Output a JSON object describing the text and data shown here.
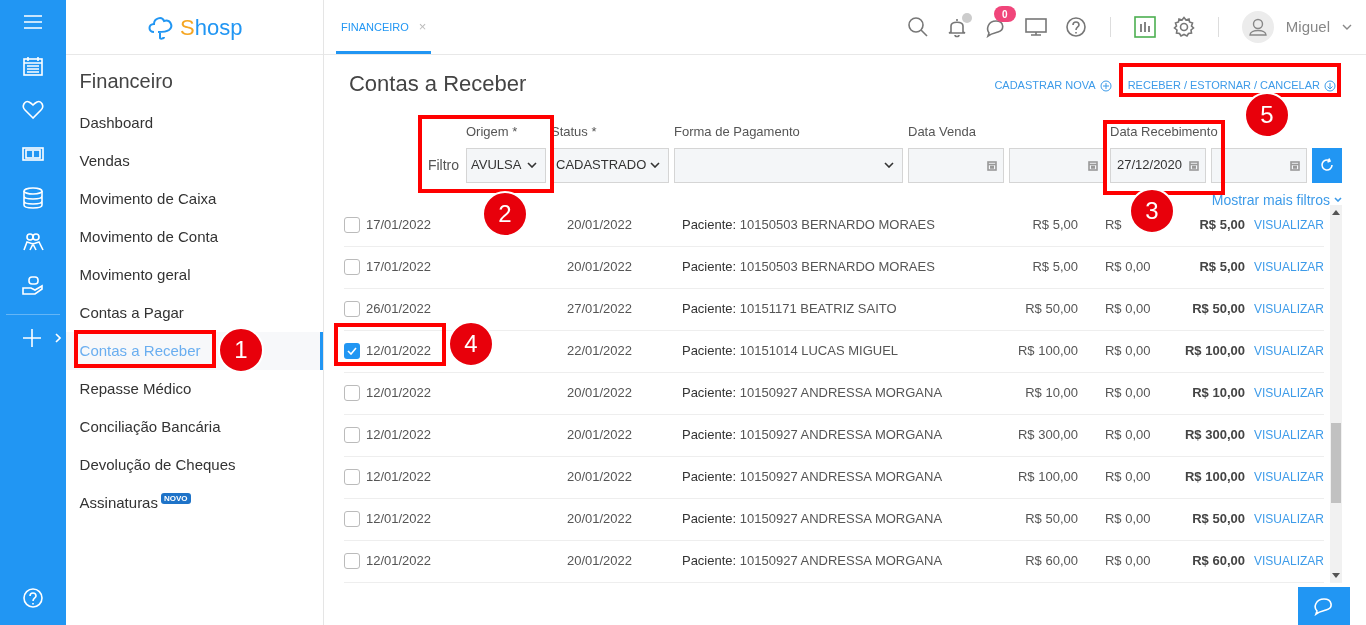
{
  "logo": {
    "accent": "S",
    "rest": "hosp"
  },
  "tabs": [
    {
      "label": "FINANCEIRO",
      "selected": true,
      "close": "×"
    }
  ],
  "header": {
    "messages_badge": "0",
    "user": "Miguel"
  },
  "sidebar": {
    "title": "Financeiro",
    "items": [
      {
        "label": "Dashboard",
        "selected": false
      },
      {
        "label": "Vendas",
        "selected": false
      },
      {
        "label": "Movimento de Caixa",
        "selected": false
      },
      {
        "label": "Movimento de Conta",
        "selected": false
      },
      {
        "label": "Movimento geral",
        "selected": false
      },
      {
        "label": "Contas a Pagar",
        "selected": false
      },
      {
        "label": "Contas a Receber",
        "selected": true
      },
      {
        "label": "Repasse Médico",
        "selected": false
      },
      {
        "label": "Conciliação Bancária",
        "selected": false
      },
      {
        "label": "Devolução de Cheques",
        "selected": false
      },
      {
        "label": "Assinaturas",
        "selected": false,
        "badge": "NOVO"
      }
    ]
  },
  "page": {
    "title": "Contas a Receber",
    "actions": [
      {
        "label": "CADASTRAR NOVA",
        "kind": "add"
      },
      {
        "label": "RECEBER / ESTORNAR / CANCELAR",
        "kind": "receive"
      }
    ]
  },
  "filters": {
    "label": "Filtro",
    "more": "Mostrar mais filtros",
    "fields": [
      {
        "label": "Origem *",
        "kind": "select",
        "value": "AVULSA"
      },
      {
        "label": "Status *",
        "kind": "select",
        "value": "CADASTRADO"
      },
      {
        "label": "Forma de Pagamento",
        "kind": "select"
      },
      {
        "label": "Data Venda",
        "kind": "date-range"
      },
      {
        "label": "Data Recebimento",
        "kind": "date-range",
        "from": "27/12/2020"
      }
    ]
  },
  "rows": [
    {
      "checked": false,
      "date": "17/01/2022",
      "due": "20/01/2022",
      "patient_label": "Paciente:",
      "patient": "10150503 BERNARDO MORAES",
      "value": "R$ 5,00",
      "discount": "R$",
      "total": "R$ 5,00",
      "action": "VISUALIZAR"
    },
    {
      "checked": false,
      "date": "17/01/2022",
      "due": "20/01/2022",
      "patient_label": "Paciente:",
      "patient": "10150503 BERNARDO MORAES",
      "value": "R$ 5,00",
      "discount": "R$ 0,00",
      "total": "R$ 5,00",
      "action": "VISUALIZAR"
    },
    {
      "checked": false,
      "date": "26/01/2022",
      "due": "27/01/2022",
      "patient_label": "Paciente:",
      "patient": "10151171 BEATRIZ SAITO",
      "value": "R$ 50,00",
      "discount": "R$ 0,00",
      "total": "R$ 50,00",
      "action": "VISUALIZAR"
    },
    {
      "checked": true,
      "date": "12/01/2022",
      "due": "22/01/2022",
      "patient_label": "Paciente:",
      "patient": "10151014 LUCAS MIGUEL",
      "value": "R$ 100,00",
      "discount": "R$ 0,00",
      "total": "R$ 100,00",
      "action": "VISUALIZAR"
    },
    {
      "checked": false,
      "date": "12/01/2022",
      "due": "20/01/2022",
      "patient_label": "Paciente:",
      "patient": "10150927 ANDRESSA MORGANA",
      "value": "R$ 10,00",
      "discount": "R$ 0,00",
      "total": "R$ 10,00",
      "action": "VISUALIZAR"
    },
    {
      "checked": false,
      "date": "12/01/2022",
      "due": "20/01/2022",
      "patient_label": "Paciente:",
      "patient": "10150927 ANDRESSA MORGANA",
      "value": "R$ 300,00",
      "discount": "R$ 0,00",
      "total": "R$ 300,00",
      "action": "VISUALIZAR"
    },
    {
      "checked": false,
      "date": "12/01/2022",
      "due": "20/01/2022",
      "patient_label": "Paciente:",
      "patient": "10150927 ANDRESSA MORGANA",
      "value": "R$ 100,00",
      "discount": "R$ 0,00",
      "total": "R$ 100,00",
      "action": "VISUALIZAR"
    },
    {
      "checked": false,
      "date": "12/01/2022",
      "due": "20/01/2022",
      "patient_label": "Paciente:",
      "patient": "10150927 ANDRESSA MORGANA",
      "value": "R$ 50,00",
      "discount": "R$ 0,00",
      "total": "R$ 50,00",
      "action": "VISUALIZAR"
    },
    {
      "checked": false,
      "date": "12/01/2022",
      "due": "20/01/2022",
      "patient_label": "Paciente:",
      "patient": "10150927 ANDRESSA MORGANA",
      "value": "R$ 60,00",
      "discount": "R$ 0,00",
      "total": "R$ 60,00",
      "action": "VISUALIZAR"
    }
  ],
  "annotations": [
    {
      "label": "1"
    },
    {
      "label": "2"
    },
    {
      "label": "3"
    },
    {
      "label": "4"
    },
    {
      "label": "5"
    }
  ]
}
